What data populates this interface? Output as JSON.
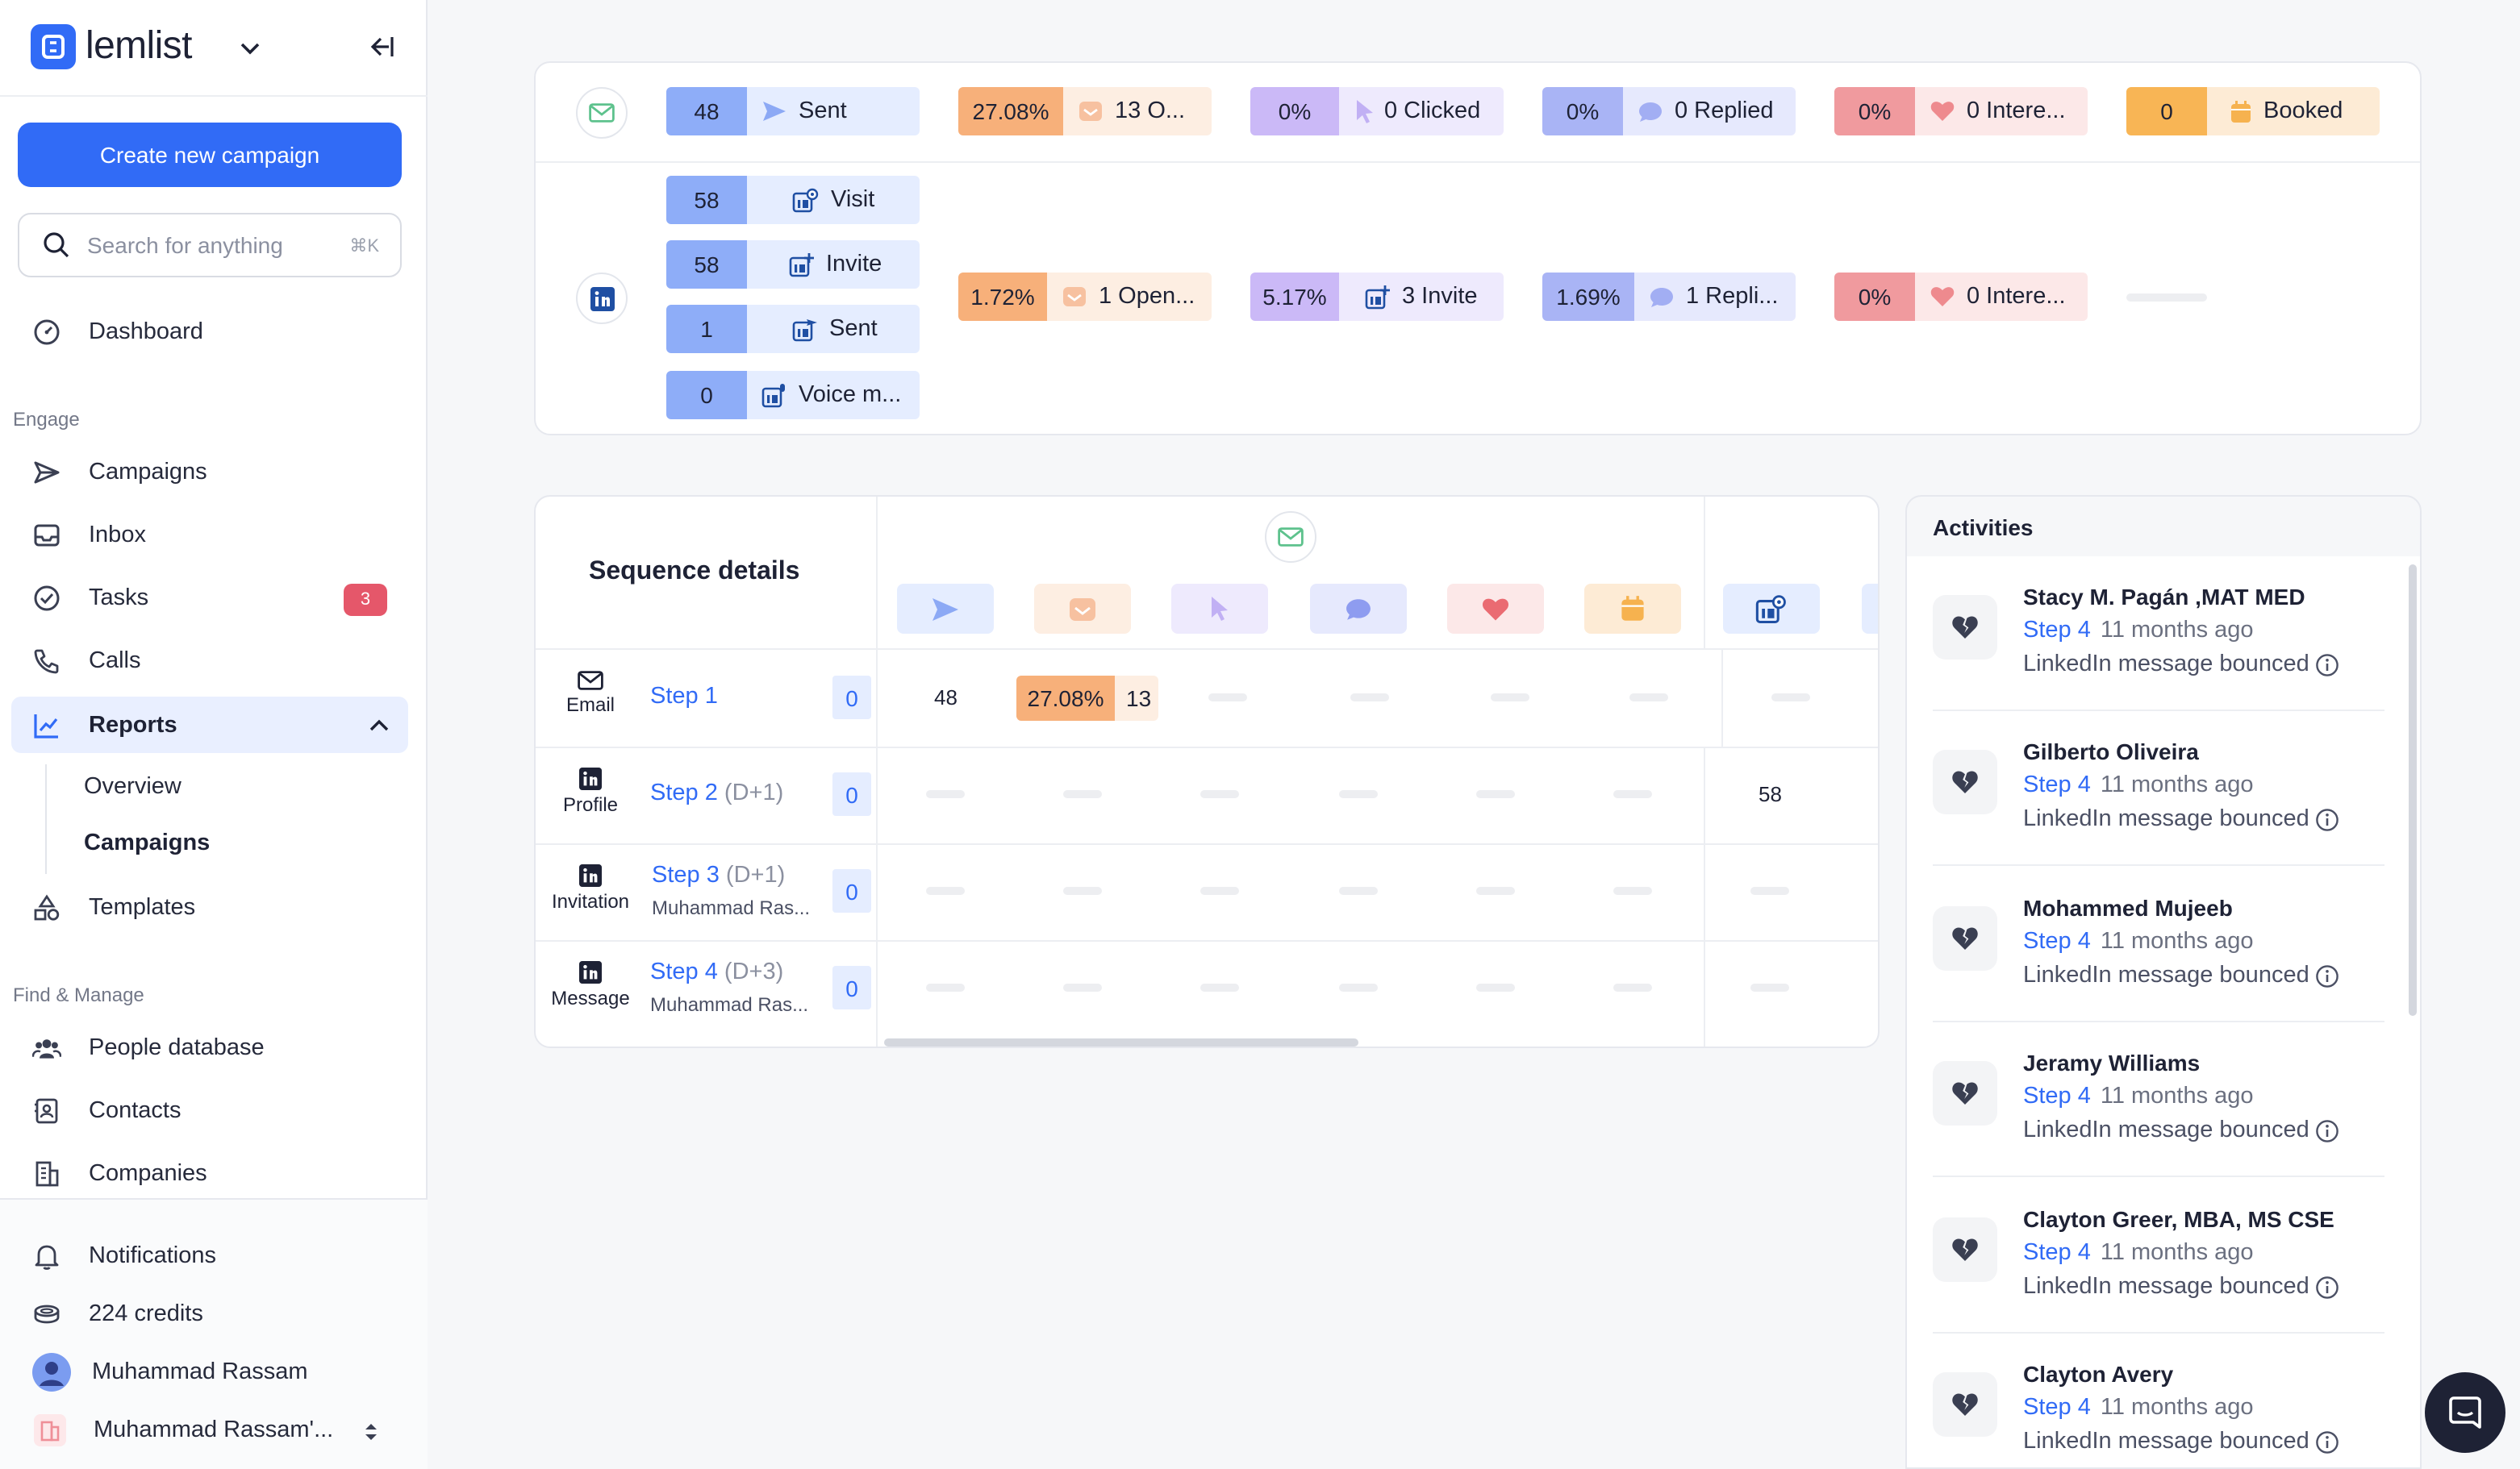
{
  "sidebar": {
    "brand": "lemlist",
    "create_button": "Create new campaign",
    "search_placeholder": "Search for anything",
    "search_shortcut": "⌘K",
    "nav": {
      "dashboard": "Dashboard",
      "engage_group": "Engage",
      "campaigns": "Campaigns",
      "inbox": "Inbox",
      "tasks": "Tasks",
      "tasks_badge": "3",
      "calls": "Calls",
      "reports": "Reports",
      "overview": "Overview",
      "reports_campaigns": "Campaigns",
      "templates": "Templates",
      "find_group": "Find & Manage",
      "people_database": "People database",
      "contacts": "Contacts",
      "companies": "Companies"
    },
    "footer": {
      "notifications": "Notifications",
      "credits": "224 credits",
      "user": "Muhammad Rassam",
      "workspace": "Muhammad Rassam'..."
    }
  },
  "summary": {
    "email": {
      "sent_count": "48",
      "sent_label": "Sent",
      "opened_pct": "27.08%",
      "opened_label": "13 O...",
      "clicked_pct": "0%",
      "clicked_label": "0 Clicked",
      "replied_pct": "0%",
      "replied_label": "0 Replied",
      "interested_pct": "0%",
      "interested_label": "0 Intere...",
      "booked_count": "0",
      "booked_label": "Booked"
    },
    "linkedin": {
      "visit_count": "58",
      "visit_label": "Visit",
      "invite_count": "58",
      "invite_label": "Invite",
      "sent_count": "1",
      "sent_label": "Sent",
      "voice_count": "0",
      "voice_label": "Voice m...",
      "opened_pct": "1.72%",
      "opened_label": "1 Open...",
      "accepted_pct": "5.17%",
      "accepted_label": "3 Invite",
      "replied_pct": "1.69%",
      "replied_label": "1 Repli...",
      "interested_pct": "0%",
      "interested_label": "0 Intere..."
    }
  },
  "sequence": {
    "title": "Sequence details",
    "steps": [
      {
        "type": "Email",
        "name": "Step 1",
        "delay": "",
        "sender": "",
        "count": "0",
        "sent": "48",
        "opened_pct": "27.08%",
        "opened": "13"
      },
      {
        "type": "Profile",
        "name": "Step 2",
        "delay": "(D+1)",
        "sender": "",
        "count": "0",
        "visits": "58"
      },
      {
        "type": "Invitation",
        "name": "Step 3",
        "delay": "(D+1)",
        "sender": "Muhammad Ras...",
        "count": "0"
      },
      {
        "type": "Message",
        "name": "Step 4",
        "delay": "(D+3)",
        "sender": "Muhammad Ras...",
        "count": "0"
      }
    ]
  },
  "activities": {
    "title": "Activities",
    "items": [
      {
        "name": "Stacy M. Pagán ,MAT MED",
        "step": "Step 4",
        "time": "11 months ago",
        "message": "LinkedIn message bounced"
      },
      {
        "name": "Gilberto Oliveira",
        "step": "Step 4",
        "time": "11 months ago",
        "message": "LinkedIn message bounced"
      },
      {
        "name": "Mohammed Mujeeb",
        "step": "Step 4",
        "time": "11 months ago",
        "message": "LinkedIn message bounced"
      },
      {
        "name": "Jeramy Williams",
        "step": "Step 4",
        "time": "11 months ago",
        "message": "LinkedIn message bounced"
      },
      {
        "name": "Clayton Greer, MBA, MS CSE",
        "step": "Step 4",
        "time": "11 months ago",
        "message": "LinkedIn message bounced"
      },
      {
        "name": "Clayton Avery",
        "step": "Step 4",
        "time": "11 months ago",
        "message": "LinkedIn message bounced"
      }
    ]
  },
  "colors": {
    "accent": "#316bf6",
    "badge": "#e5576a"
  }
}
